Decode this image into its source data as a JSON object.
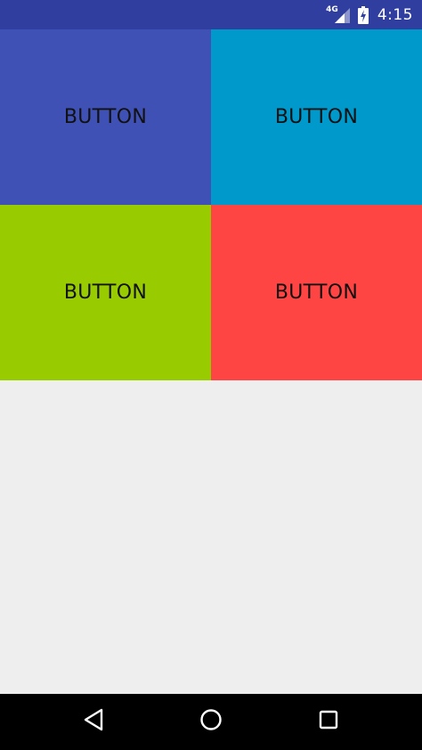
{
  "status_bar": {
    "network_label": "4G",
    "time": "4:15",
    "background": "#303f9f",
    "icons": [
      "signal-icon",
      "battery-charging-icon"
    ]
  },
  "buttons": [
    {
      "label": "BUTTON",
      "color": "#3f51b5"
    },
    {
      "label": "BUTTON",
      "color": "#0099cc"
    },
    {
      "label": "BUTTON",
      "color": "#99cc00"
    },
    {
      "label": "BUTTON",
      "color": "#ff4444"
    }
  ],
  "content_background": "#eeeeee",
  "nav_bar": {
    "background": "#000000",
    "icons": [
      "back-icon",
      "home-icon",
      "recents-icon"
    ]
  }
}
